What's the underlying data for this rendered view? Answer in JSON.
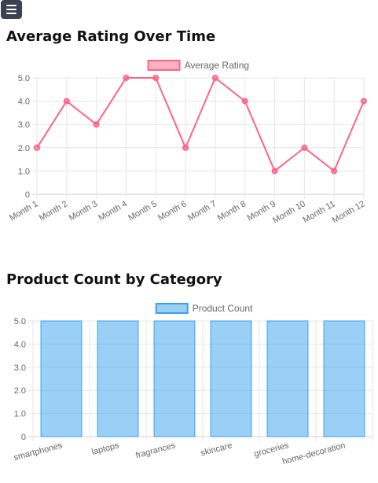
{
  "nav": {
    "menu_icon": "hamburger-menu-icon"
  },
  "charts": [
    {
      "title": "Average Rating Over Time",
      "chart_data": {
        "type": "line",
        "categories": [
          "Month 1",
          "Month 2",
          "Month 3",
          "Month 4",
          "Month 5",
          "Month 6",
          "Month 7",
          "Month 8",
          "Month 9",
          "Month 10",
          "Month 11",
          "Month 12"
        ],
        "series": [
          {
            "name": "Average Rating",
            "values": [
              2,
              4,
              3,
              5,
              5,
              2,
              5,
              4,
              1,
              2,
              1,
              4
            ],
            "color": "#ff6384"
          }
        ],
        "ylim": [
          0,
          5
        ],
        "yticks": [
          "0",
          "1.0",
          "2.0",
          "3.0",
          "4.0",
          "5.0"
        ],
        "grid": true,
        "legend": "top"
      }
    },
    {
      "title": "Product Count by Category",
      "chart_data": {
        "type": "bar",
        "categories": [
          "smartphones",
          "laptops",
          "fragrances",
          "skincare",
          "groceries",
          "home-decoration"
        ],
        "series": [
          {
            "name": "Product Count",
            "values": [
              5,
              5,
              5,
              5,
              5,
              5
            ],
            "color": "#36a2eb"
          }
        ],
        "ylim": [
          0,
          5
        ],
        "yticks": [
          "0",
          "1.0",
          "2.0",
          "3.0",
          "4.0",
          "5.0"
        ],
        "grid": true,
        "legend": "top"
      }
    }
  ]
}
